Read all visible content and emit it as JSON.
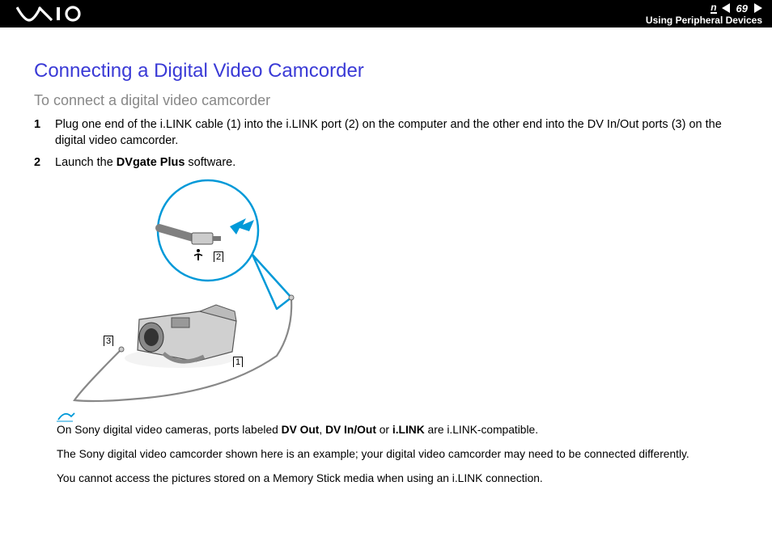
{
  "header": {
    "page_number": "69",
    "n_marker": "n",
    "section": "Using Peripheral Devices"
  },
  "title": "Connecting a Digital Video Camcorder",
  "subtitle": "To connect a digital video camcorder",
  "steps": [
    {
      "num": "1",
      "text": "Plug one end of the i.LINK cable (1) into the i.LINK port (2) on the computer and the other end into the DV In/Out ports (3) on the digital video camcorder."
    },
    {
      "num": "2",
      "before": "Launch the ",
      "bold": "DVgate Plus",
      "after": " software."
    }
  ],
  "diagram": {
    "label1": "1",
    "label2": "2",
    "label3": "3"
  },
  "notes": {
    "line1_a": "On Sony digital video cameras, ports labeled ",
    "line1_b1": "DV Out",
    "line1_c1": ", ",
    "line1_b2": "DV In/Out",
    "line1_c2": " or ",
    "line1_b3": "i.LINK",
    "line1_d": " are i.LINK-compatible.",
    "line2": "The Sony digital video camcorder shown here is an example; your digital video camcorder may need to be connected differently.",
    "line3": "You cannot access the pictures stored on a Memory Stick media when using an i.LINK connection."
  }
}
